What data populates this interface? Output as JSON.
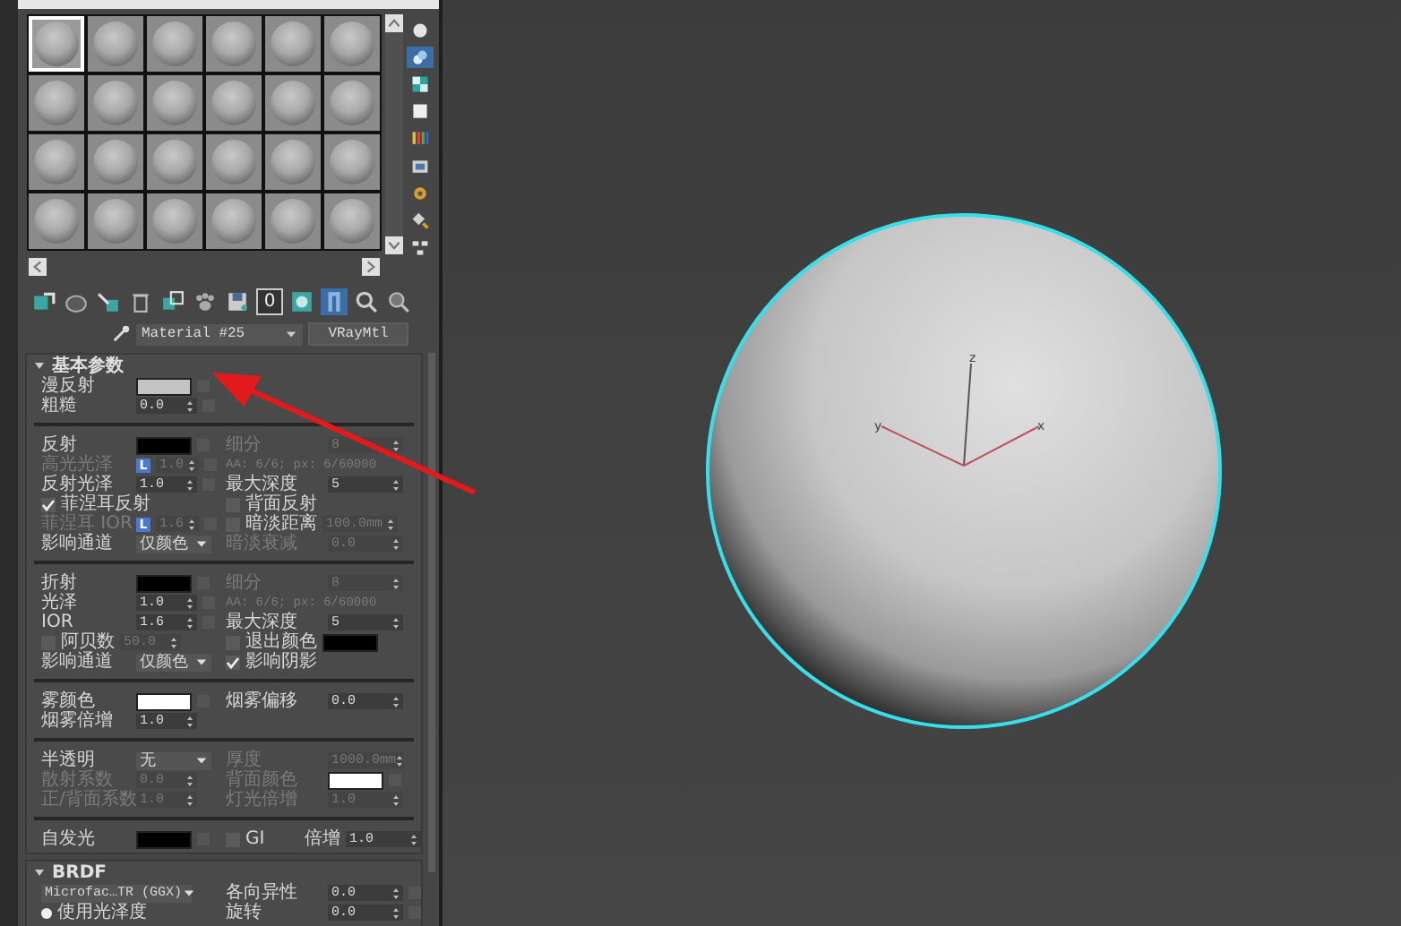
{
  "sample_slots": [
    {
      "selected": true
    },
    {
      "selected": false
    },
    {
      "selected": false
    },
    {
      "selected": false
    },
    {
      "selected": false
    },
    {
      "selected": false
    },
    {
      "selected": false
    },
    {
      "selected": false
    },
    {
      "selected": false
    },
    {
      "selected": false
    },
    {
      "selected": false
    },
    {
      "selected": false
    },
    {
      "selected": false
    },
    {
      "selected": false
    },
    {
      "selected": false
    },
    {
      "selected": false
    },
    {
      "selected": false
    },
    {
      "selected": false
    },
    {
      "selected": false
    },
    {
      "selected": false
    },
    {
      "selected": false
    },
    {
      "selected": false
    },
    {
      "selected": false
    },
    {
      "selected": false
    }
  ],
  "side_toolbar": [
    {
      "kind": "sphere",
      "selected": false
    },
    {
      "kind": "backlight",
      "selected": true
    },
    {
      "kind": "checker",
      "selected": false
    },
    {
      "kind": "square",
      "selected": false
    },
    {
      "kind": "bars",
      "selected": false
    },
    {
      "kind": "film",
      "selected": false
    },
    {
      "kind": "gear",
      "selected": false
    },
    {
      "kind": "pick",
      "selected": false
    },
    {
      "kind": "tree",
      "selected": false
    }
  ],
  "material_toolbar": [
    {
      "kind": "get",
      "selected": false
    },
    {
      "kind": "put",
      "selected": false
    },
    {
      "kind": "assign",
      "selected": false
    },
    {
      "kind": "trash",
      "selected": false
    },
    {
      "kind": "copy",
      "selected": false
    },
    {
      "kind": "paw",
      "selected": false
    },
    {
      "kind": "save",
      "selected": false
    },
    {
      "kind": "id",
      "label": "0",
      "selected": false
    },
    {
      "kind": "map",
      "selected": false
    },
    {
      "kind": "result",
      "selected": true
    },
    {
      "kind": "parent",
      "selected": false
    },
    {
      "kind": "sibling",
      "selected": false
    }
  ],
  "material": {
    "name": "Material #25",
    "type": "VRayMtl"
  },
  "rollouts": [
    {
      "title": "基本参数",
      "expanded": true,
      "groups": [
        {
          "rows": [
            {
              "cells": [
                {
                  "kind": "field",
                  "label": "漫反射",
                  "control": {
                    "kind": "swatch",
                    "color": "#c4c4c4"
                  },
                  "map_slot": true
                }
              ]
            },
            {
              "cells": [
                {
                  "kind": "field",
                  "label": "粗糙",
                  "control": {
                    "kind": "spinner",
                    "value": "0.0"
                  },
                  "map_slot": true
                }
              ]
            }
          ]
        },
        {
          "rows": [
            {
              "cells": [
                {
                  "kind": "field",
                  "label": "反射",
                  "control": {
                    "kind": "swatch",
                    "color": "#000000"
                  },
                  "map_slot": true
                },
                {
                  "kind": "field",
                  "label": "细分",
                  "disabled": true,
                  "control": {
                    "kind": "spinner",
                    "value": "8"
                  }
                }
              ]
            },
            {
              "cells": [
                {
                  "kind": "field",
                  "label": "高光光泽",
                  "disabled": true,
                  "control": {
                    "kind": "spinner",
                    "value": "1.0",
                    "badge": "L"
                  },
                  "map_slot": true
                },
                {
                  "kind": "note",
                  "text": "AA: 6/6; px: 6/60000",
                  "disabled": true
                }
              ]
            },
            {
              "cells": [
                {
                  "kind": "field",
                  "label": "反射光泽",
                  "control": {
                    "kind": "spinner",
                    "value": "1.0"
                  },
                  "map_slot": true
                },
                {
                  "kind": "field",
                  "label": "最大深度",
                  "control": {
                    "kind": "spinner",
                    "value": "5"
                  }
                }
              ]
            },
            {
              "cells": [
                {
                  "kind": "check",
                  "label": "菲涅耳反射",
                  "checked": true
                },
                {
                  "kind": "check",
                  "label": "背面反射",
                  "checked": false
                }
              ]
            },
            {
              "cells": [
                {
                  "kind": "field",
                  "label": "菲涅耳 IOR",
                  "disabled": true,
                  "control": {
                    "kind": "spinner",
                    "value": "1.6",
                    "badge": "L"
                  },
                  "map_slot": true
                },
                {
                  "kind": "check",
                  "label": "暗淡距离",
                  "checked": false,
                  "control": {
                    "kind": "spinner",
                    "value": "100.0mm",
                    "disabled": true
                  }
                }
              ]
            },
            {
              "cells": [
                {
                  "kind": "field",
                  "label": "影响通道",
                  "control": {
                    "kind": "dropdown",
                    "value": "仅颜色"
                  }
                },
                {
                  "kind": "field",
                  "label": "暗淡衰减",
                  "disabled": true,
                  "control": {
                    "kind": "spinner",
                    "value": "0.0"
                  }
                }
              ]
            }
          ]
        },
        {
          "rows": [
            {
              "cells": [
                {
                  "kind": "field",
                  "label": "折射",
                  "control": {
                    "kind": "swatch",
                    "color": "#000000"
                  },
                  "map_slot": true
                },
                {
                  "kind": "field",
                  "label": "细分",
                  "disabled": true,
                  "control": {
                    "kind": "spinner",
                    "value": "8"
                  }
                }
              ]
            },
            {
              "cells": [
                {
                  "kind": "field",
                  "label": "光泽",
                  "control": {
                    "kind": "spinner",
                    "value": "1.0"
                  },
                  "map_slot": true
                },
                {
                  "kind": "note",
                  "text": "AA: 6/6; px: 6/60000",
                  "disabled": true
                }
              ]
            },
            {
              "cells": [
                {
                  "kind": "field",
                  "label": "IOR",
                  "control": {
                    "kind": "spinner",
                    "value": "1.6"
                  },
                  "map_slot": true
                },
                {
                  "kind": "field",
                  "label": "最大深度",
                  "control": {
                    "kind": "spinner",
                    "value": "5"
                  }
                }
              ]
            },
            {
              "cells": [
                {
                  "kind": "check",
                  "label": "阿贝数",
                  "checked": false,
                  "control": {
                    "kind": "spinner",
                    "value": "50.0",
                    "disabled": true
                  }
                },
                {
                  "kind": "check",
                  "label": "退出颜色",
                  "checked": false,
                  "control": {
                    "kind": "swatch",
                    "color": "#000000"
                  }
                }
              ]
            },
            {
              "cells": [
                {
                  "kind": "field",
                  "label": "影响通道",
                  "control": {
                    "kind": "dropdown",
                    "value": "仅颜色"
                  }
                },
                {
                  "kind": "check",
                  "label": "影响阴影",
                  "checked": true
                }
              ]
            }
          ]
        },
        {
          "rows": [
            {
              "cells": [
                {
                  "kind": "field",
                  "label": "雾颜色",
                  "control": {
                    "kind": "swatch",
                    "color": "#ffffff"
                  },
                  "map_slot": true
                },
                {
                  "kind": "field",
                  "label": "烟雾偏移",
                  "control": {
                    "kind": "spinner",
                    "value": "0.0"
                  }
                }
              ]
            },
            {
              "cells": [
                {
                  "kind": "field",
                  "label": "烟雾倍增",
                  "control": {
                    "kind": "spinner",
                    "value": "1.0"
                  }
                }
              ]
            }
          ]
        },
        {
          "rows": [
            {
              "cells": [
                {
                  "kind": "field",
                  "label": "半透明",
                  "control": {
                    "kind": "dropdown",
                    "value": "无"
                  }
                },
                {
                  "kind": "field",
                  "label": "厚度",
                  "disabled": true,
                  "control": {
                    "kind": "spinner",
                    "value": "1000.0mm"
                  }
                }
              ]
            },
            {
              "cells": [
                {
                  "kind": "field",
                  "label": "散射系数",
                  "disabled": true,
                  "control": {
                    "kind": "spinner",
                    "value": "0.0"
                  }
                },
                {
                  "kind": "field",
                  "label": "背面颜色",
                  "disabled": true,
                  "control": {
                    "kind": "swatch",
                    "color": "#ffffff"
                  },
                  "map_slot": true
                }
              ]
            },
            {
              "cells": [
                {
                  "kind": "field",
                  "label": "正/背面系数",
                  "disabled": true,
                  "control": {
                    "kind": "spinner",
                    "value": "1.0"
                  }
                },
                {
                  "kind": "field",
                  "label": "灯光倍增",
                  "disabled": true,
                  "control": {
                    "kind": "spinner",
                    "value": "1.0"
                  }
                }
              ]
            }
          ]
        },
        {
          "rows": [
            {
              "cells": [
                {
                  "kind": "field",
                  "label": "自发光",
                  "control": {
                    "kind": "swatch",
                    "color": "#000000"
                  },
                  "map_slot": true
                },
                {
                  "kind": "check",
                  "label": "GI",
                  "checked": false
                },
                {
                  "kind": "field",
                  "label": "倍增",
                  "control": {
                    "kind": "spinner",
                    "value": "1.0"
                  }
                }
              ]
            }
          ]
        }
      ]
    },
    {
      "title": "BRDF",
      "expanded": true,
      "groups": [
        {
          "rows": [
            {
              "cells": [
                {
                  "kind": "control",
                  "control": {
                    "kind": "dropdown",
                    "value": "Microfac…TR (GGX)"
                  }
                },
                {
                  "kind": "field",
                  "label": "各向异性",
                  "control": {
                    "kind": "spinner",
                    "value": "0.0"
                  },
                  "map_slot": true
                }
              ]
            },
            {
              "cells": [
                {
                  "kind": "radio",
                  "label": "使用光泽度",
                  "selected": true
                },
                {
                  "kind": "field",
                  "label": "旋转",
                  "control": {
                    "kind": "spinner",
                    "value": "0.0"
                  },
                  "map_slot": true
                }
              ]
            }
          ]
        }
      ]
    }
  ],
  "viewport": {
    "axes": [
      {
        "label": "z"
      },
      {
        "label": "y"
      },
      {
        "label": "x"
      }
    ]
  }
}
